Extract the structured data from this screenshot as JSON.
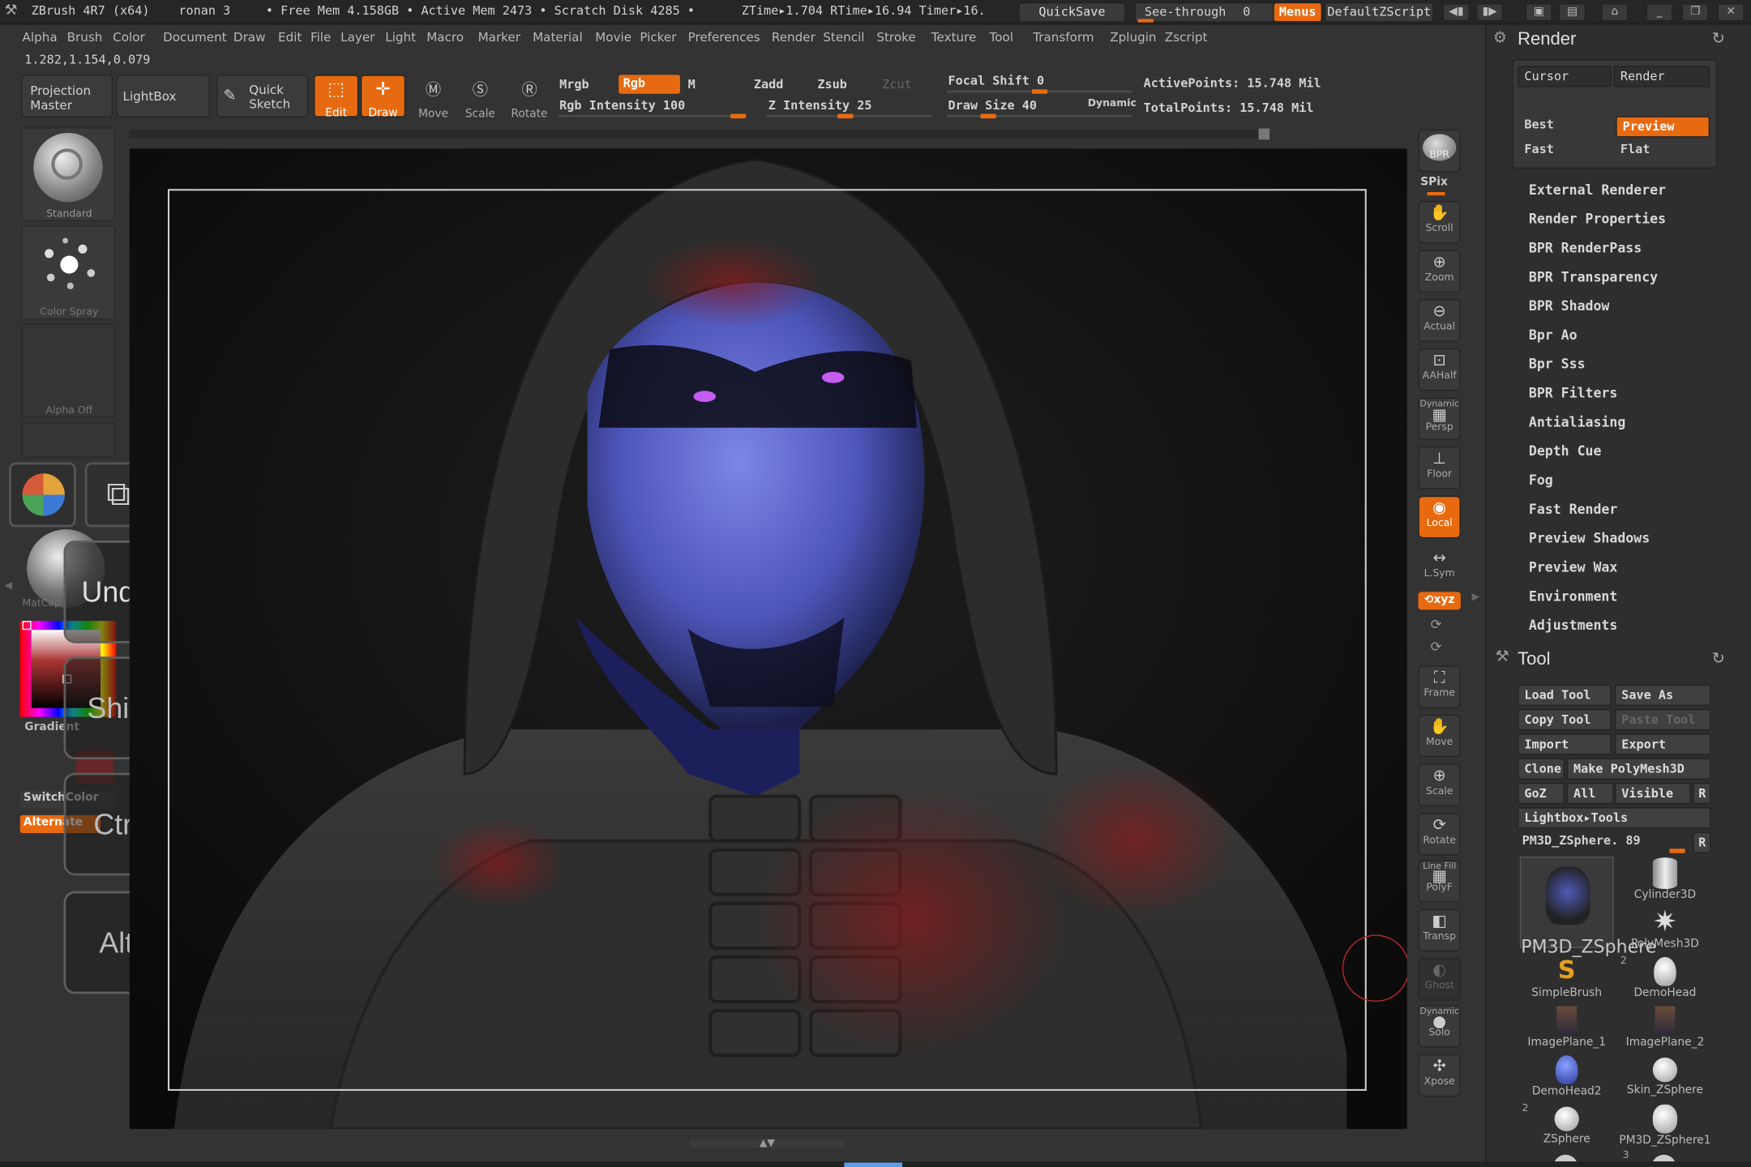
{
  "titlebar": {
    "app": "ZBrush 4R7 (x64)",
    "doc": "ronan 3",
    "free_mem": "• Free Mem 4.158GB • Active Mem 2473 • Scratch Disk 4285 •",
    "timing": "ZTime▸1.704 RTime▸16.94 Timer▸16.",
    "quicksave": "QuickSave",
    "see_through": "See-through",
    "see_through_val": "0",
    "menus": "Menus",
    "script": "DefaultZScript"
  },
  "menubar": [
    "Alpha",
    "Brush",
    "Color",
    "Document",
    "Draw",
    "Edit",
    "File",
    "Layer",
    "Light",
    "Macro",
    "Marker",
    "Material",
    "Movie",
    "Picker",
    "Preferences",
    "Render",
    "Stencil",
    "Stroke",
    "Texture",
    "Tool",
    "Transform",
    "Zplugin",
    "Zscript"
  ],
  "coords": "1.282,1.154,0.079",
  "toolbar": {
    "projection_master": "Projection\nMaster",
    "lightbox": "LightBox",
    "quick_sketch": "Quick\nSketch",
    "edit": "Edit",
    "draw": "Draw",
    "move": "Move",
    "scale": "Scale",
    "rotate": "Rotate",
    "mrgb": "Mrgb",
    "rgb": "Rgb",
    "m": "M",
    "rgb_intensity": "Rgb Intensity 100",
    "zadd": "Zadd",
    "zsub": "Zsub",
    "zcut": "Zcut",
    "z_intensity": "Z Intensity 25",
    "focal_shift": "Focal Shift 0",
    "draw_size": "Draw Size 40",
    "dynamic": "Dynamic",
    "active_points": "ActivePoints: 15.748 Mil",
    "total_points": "TotalPoints: 15.748 Mil"
  },
  "left_shelf": {
    "brush": "Standard",
    "stroke": "Color Spray",
    "alpha": "Alpha Off",
    "matcap": "MatCap",
    "gradient": "Gradient",
    "switch_color": "SwitchColor",
    "alternate": "Alternate",
    "undo": "Undo",
    "shift": "Shift",
    "ctrl": "Ctrl",
    "alt": "Alt"
  },
  "right_shelf": [
    "BPR",
    "SPix",
    "Scroll",
    "Zoom",
    "Actual",
    "AAHalf",
    "Dynamic",
    "Persp",
    "Floor",
    "Local",
    "L.Sym",
    "Frame",
    "Move",
    "Scale",
    "Rotate",
    "Line Fill",
    "PolyF",
    "Transp",
    "Ghost",
    "Dynamic",
    "Solo",
    "Xpose"
  ],
  "render_panel": {
    "title": "Render",
    "cursor": "Cursor",
    "render": "Render",
    "best": "Best",
    "preview": "Preview",
    "fast": "Fast",
    "flat": "Flat",
    "items": [
      "External Renderer",
      "Render Properties",
      "BPR RenderPass",
      "BPR Transparency",
      "BPR Shadow",
      "Bpr Ao",
      "Bpr Sss",
      "BPR Filters",
      "Antialiasing",
      "Depth Cue",
      "Fog",
      "Fast Render",
      "Preview Shadows",
      "Preview Wax",
      "Environment",
      "Adjustments"
    ]
  },
  "tool_panel": {
    "title": "Tool",
    "load_tool": "Load Tool",
    "save_as": "Save As",
    "copy_tool": "Copy Tool",
    "paste_tool": "Paste Tool",
    "import": "Import",
    "export": "Export",
    "clone": "Clone",
    "make_polymesh": "Make PolyMesh3D",
    "goz": "GoZ",
    "all": "All",
    "visible": "Visible",
    "r": "R",
    "lightbox_tools": "Lightbox▸Tools",
    "current_tool": "PM3D_ZSphere. 89",
    "thumbs": [
      "PM3D_ZSphere",
      "Cylinder3D",
      "PolyMesh3D",
      "SimpleBrush",
      "DemoHead",
      "ImagePlane_1",
      "ImagePlane_2",
      "DemoHead2",
      "Skin_ZSphere",
      "ZSphere",
      "PM3D_ZSphere1"
    ],
    "badges": [
      "2",
      "2",
      "3"
    ]
  },
  "colors": {
    "accent": "#e86a10",
    "bg": "#333333",
    "panel": "#2e2e2e"
  }
}
